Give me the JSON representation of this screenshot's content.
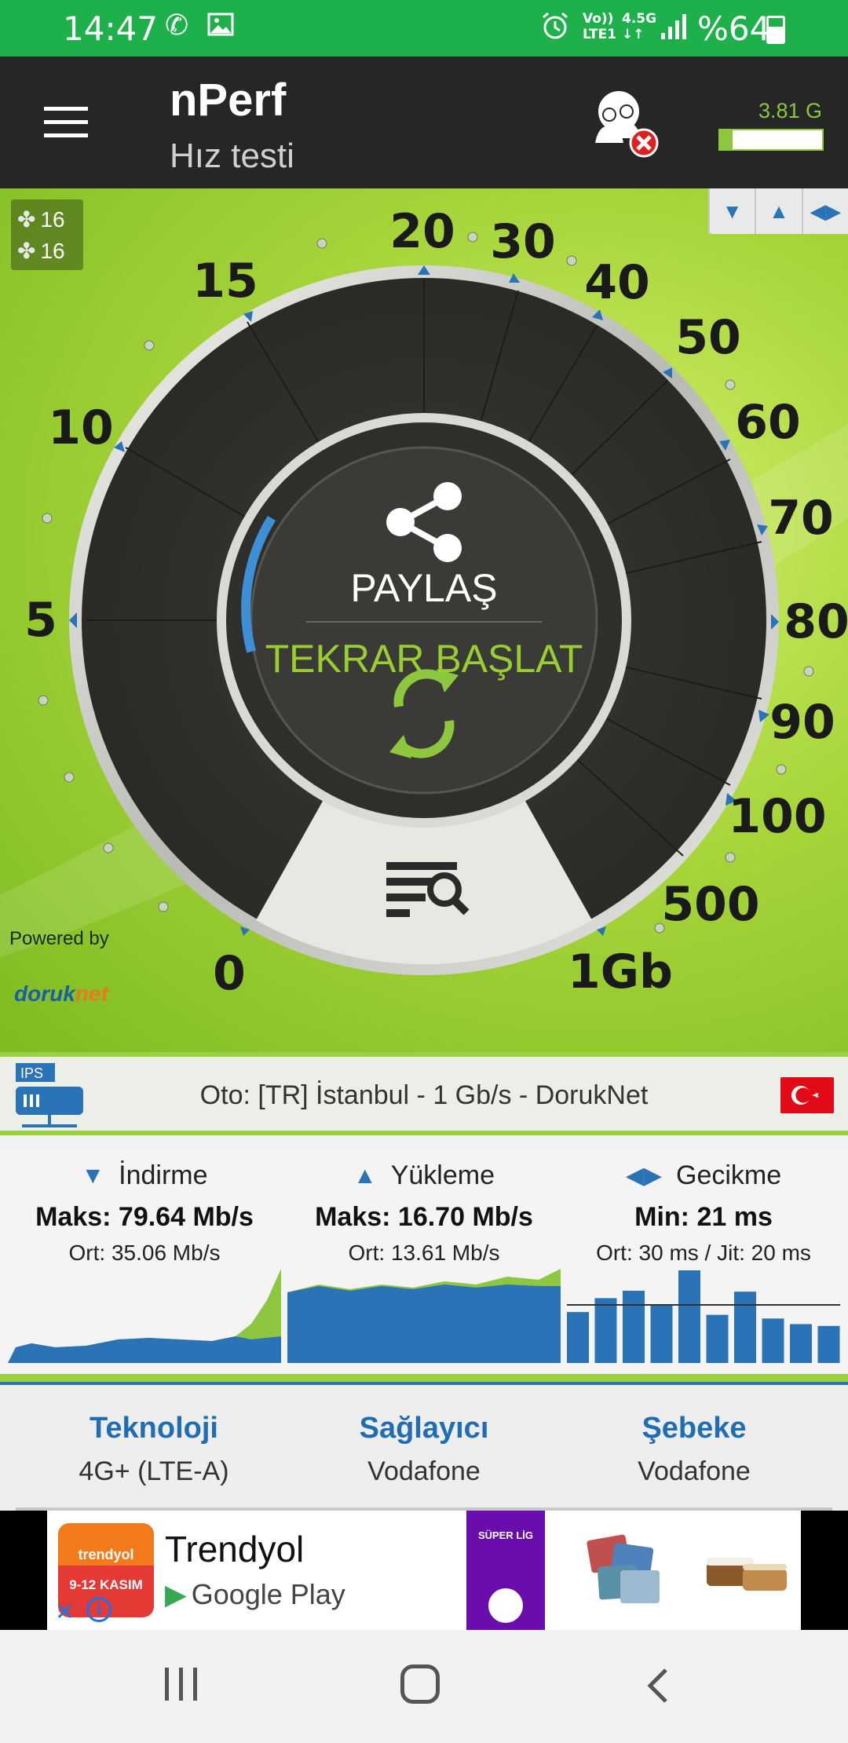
{
  "status_bar": {
    "time": "14:47",
    "net_line1": "Vo))",
    "net_line2": "LTE1",
    "net_type": "4.5G",
    "battery_text": "%64",
    "icons": [
      "phone-icon",
      "image-icon",
      "alarm-icon",
      "signal-icon",
      "battery-icon"
    ]
  },
  "app_bar": {
    "title": "nPerf",
    "subtitle": "Hız testi",
    "data_usage": "3.81 G",
    "data_usage_fill": 0.12,
    "icons": [
      "menu-icon",
      "users-disconnected-icon"
    ]
  },
  "gauge": {
    "servers_up": "16",
    "servers_down": "16",
    "scale_labels": [
      "0",
      "5",
      "10",
      "15",
      "20",
      "30",
      "40",
      "50",
      "60",
      "70",
      "80",
      "90",
      "100",
      "500",
      "1Gb"
    ],
    "share_label": "PAYLAŞ",
    "restart_label": "TEKRAR BAŞLAT",
    "powered_by": "Powered by",
    "sponsor_a": "doruk",
    "sponsor_b": "net",
    "view_toggle_icons": [
      "download-icon",
      "upload-icon",
      "latency-icon"
    ]
  },
  "server": {
    "badge": "IPS",
    "text": "Oto: [TR] İstanbul - 1 Gb/s - DorukNet",
    "flag": "turkey-flag"
  },
  "results": {
    "download": {
      "label": "İndirme",
      "max": "Maks: 79.64 Mb/s",
      "avg": "Ort: 35.06 Mb/s"
    },
    "upload": {
      "label": "Yükleme",
      "max": "Maks: 16.70 Mb/s",
      "avg": "Ort: 13.61 Mb/s"
    },
    "latency": {
      "label": "Gecikme",
      "max": "Min: 21 ms",
      "avg": "Ort: 30 ms / Jit: 20 ms"
    },
    "latency_bars": [
      55,
      70,
      78,
      62,
      100,
      52,
      77,
      48,
      42,
      40
    ]
  },
  "info": {
    "technology": {
      "label": "Teknoloji",
      "value": "4G+ (LTE-A)"
    },
    "provider": {
      "label": "Sağlayıcı",
      "value": "Vodafone"
    },
    "network": {
      "label": "Şebeke",
      "value": "Vodafone"
    }
  },
  "ad": {
    "logo_text": "trendyol",
    "logo_date": "9-12 KASIM",
    "title": "Trendyol",
    "subtitle": "Google Play",
    "promo_text": "SÜPER LİG"
  },
  "colors": {
    "status_green": "#1db04b",
    "accent_green": "#9acd32",
    "accent_blue": "#2a73b6",
    "dark": "#262626"
  }
}
